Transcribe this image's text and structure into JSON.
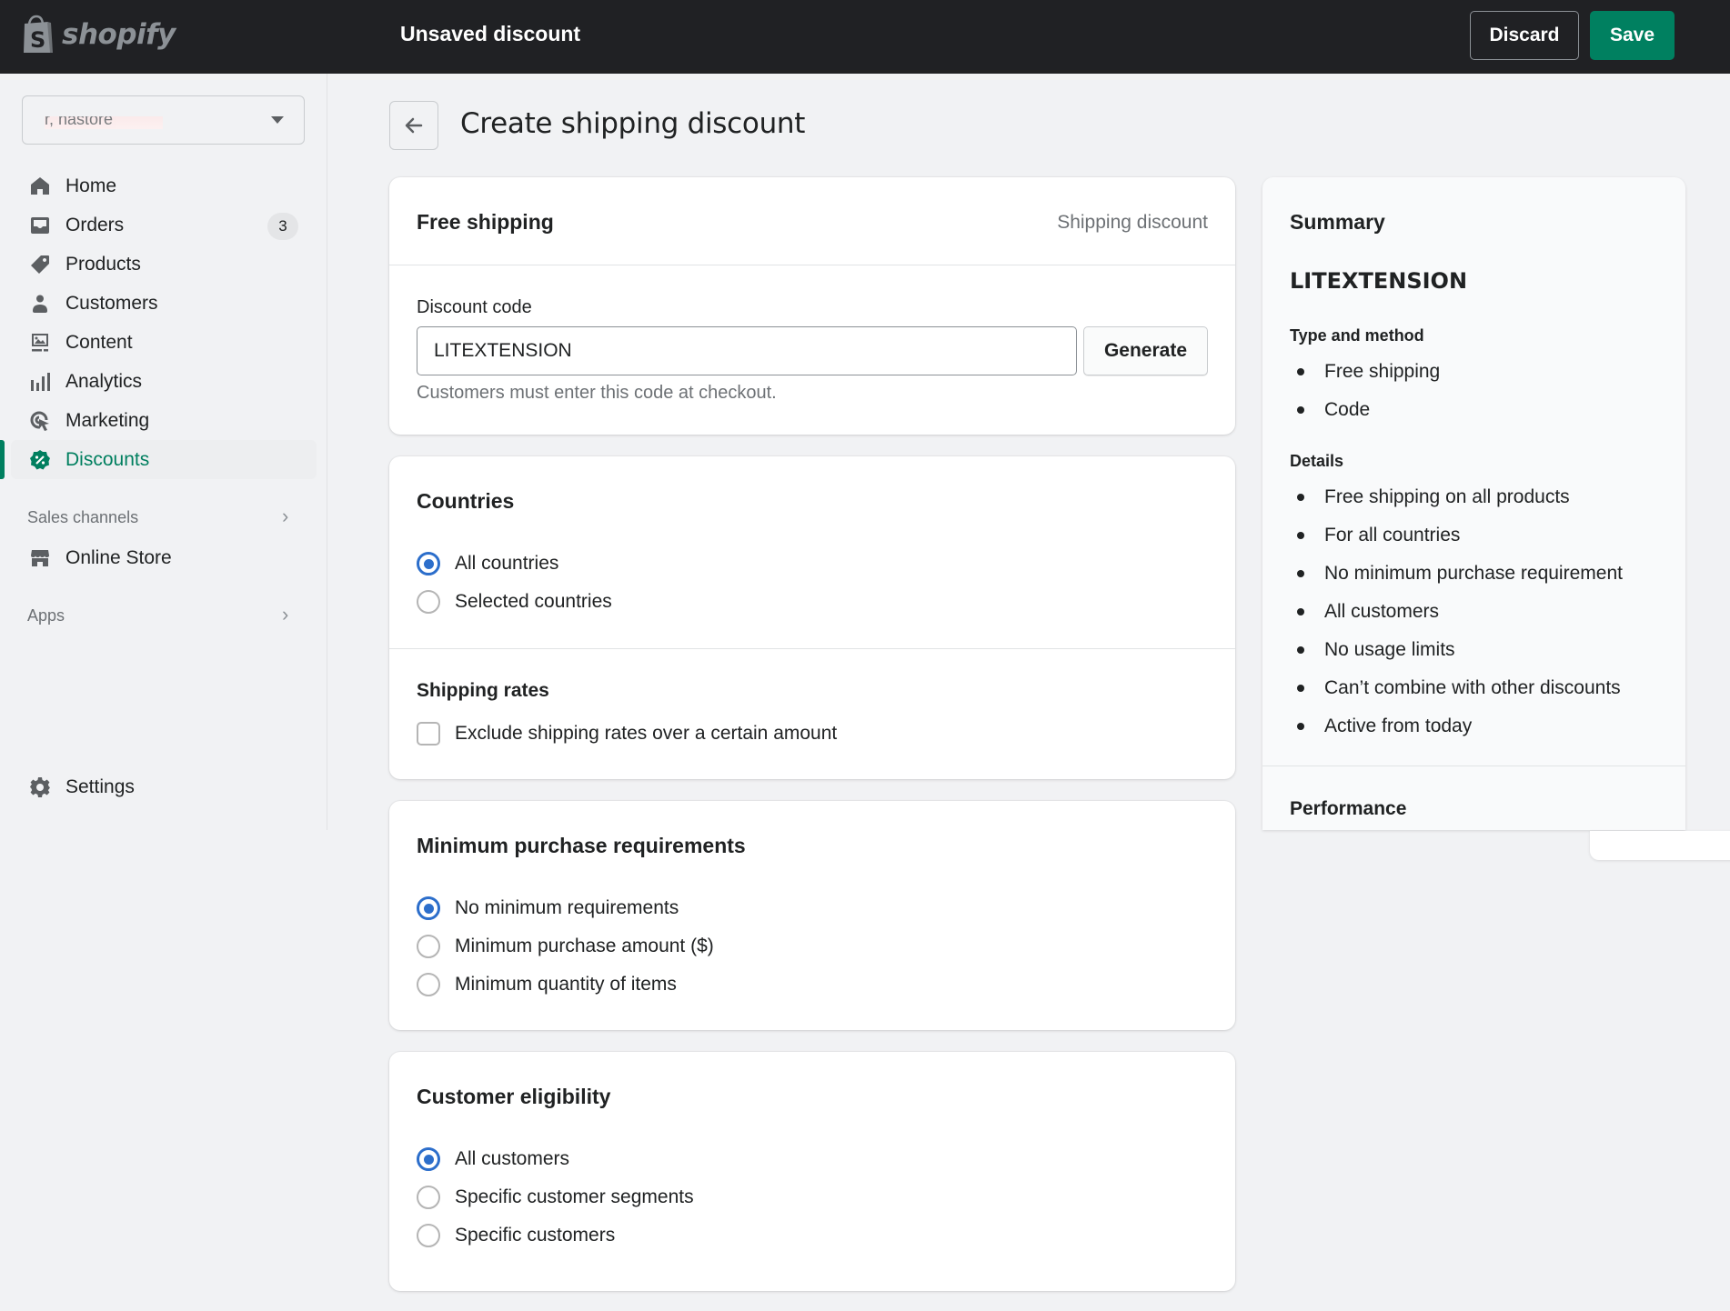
{
  "topbar": {
    "logo_text": "shopify",
    "title": "Unsaved discount",
    "discard_label": "Discard",
    "save_label": "Save",
    "save_color": "#008060"
  },
  "sidebar": {
    "store_name": "r, nastore",
    "items": [
      {
        "label": "Home",
        "icon": "home-icon"
      },
      {
        "label": "Orders",
        "icon": "orders-icon",
        "badge": "3"
      },
      {
        "label": "Products",
        "icon": "tag-icon"
      },
      {
        "label": "Customers",
        "icon": "person-icon"
      },
      {
        "label": "Content",
        "icon": "image-icon"
      },
      {
        "label": "Analytics",
        "icon": "bar-chart-icon"
      },
      {
        "label": "Marketing",
        "icon": "target-icon"
      },
      {
        "label": "Discounts",
        "icon": "discount-icon",
        "active": true
      }
    ],
    "sales_channels_label": "Sales channels",
    "online_store_label": "Online Store",
    "apps_label": "Apps",
    "settings_label": "Settings",
    "active_color": "#007f5f"
  },
  "page": {
    "title": "Create shipping discount"
  },
  "code_card": {
    "title": "Free shipping",
    "meta": "Shipping discount",
    "code_label": "Discount code",
    "code_value": "LITEXTENSION",
    "generate_label": "Generate",
    "help": "Customers must enter this code at checkout."
  },
  "countries_card": {
    "title": "Countries",
    "options": [
      {
        "label": "All countries",
        "selected": true
      },
      {
        "label": "Selected countries",
        "selected": false
      }
    ],
    "rates_title": "Shipping rates",
    "rates_checkbox": {
      "label": "Exclude shipping rates over a certain amount",
      "checked": false
    }
  },
  "min_card": {
    "title": "Minimum purchase requirements",
    "options": [
      {
        "label": "No minimum requirements",
        "selected": true
      },
      {
        "label": "Minimum purchase amount ($)",
        "selected": false
      },
      {
        "label": "Minimum quantity of items",
        "selected": false
      }
    ]
  },
  "elig_card": {
    "title": "Customer eligibility",
    "options": [
      {
        "label": "All customers",
        "selected": true
      },
      {
        "label": "Specific customer segments",
        "selected": false
      },
      {
        "label": "Specific customers",
        "selected": false
      }
    ]
  },
  "summary": {
    "title": "Summary",
    "code": "LITEXTENSION",
    "type_heading": "Type and method",
    "type_items": [
      "Free shipping",
      "Code"
    ],
    "details_heading": "Details",
    "details_items": [
      "Free shipping on all products",
      "For all countries",
      "No minimum purchase requirement",
      "All customers",
      "No usage limits",
      "Can’t combine with other discounts",
      "Active from today"
    ],
    "performance_heading": "Performance"
  }
}
